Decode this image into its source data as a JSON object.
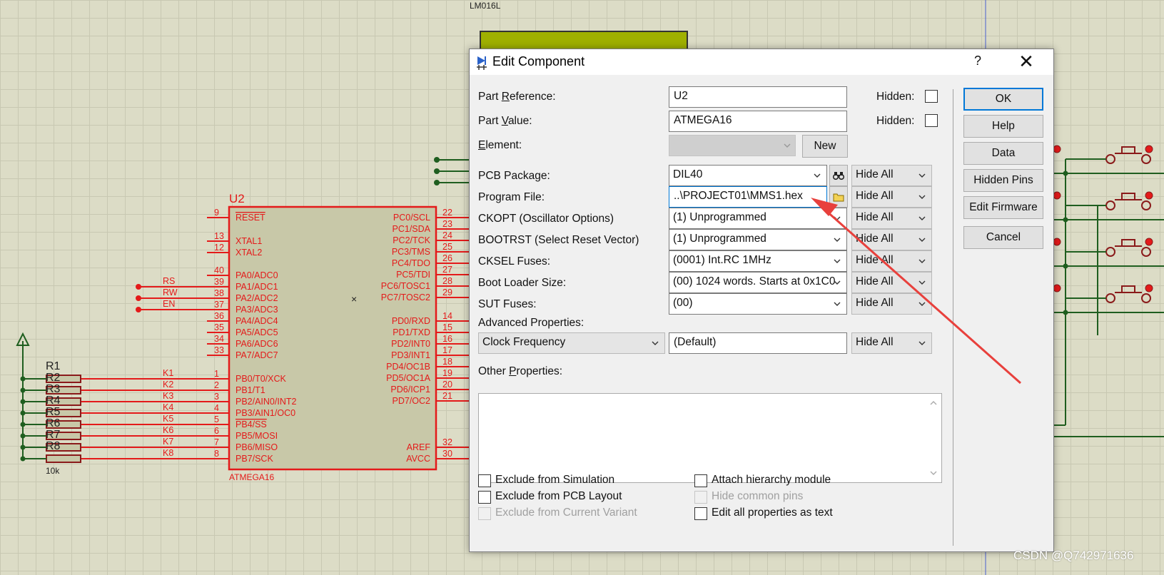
{
  "window": {
    "title": "Edit Component",
    "help_glyph": "?",
    "close_glyph": "✕"
  },
  "schematic": {
    "lcd_label": "LM016L",
    "chip": {
      "ref": "U2",
      "value": "ATMEGA16",
      "left_pins": [
        {
          "num": "9",
          "label": "RESET"
        },
        {
          "num": "13",
          "label": "XTAL1"
        },
        {
          "num": "12",
          "label": "XTAL2"
        },
        {
          "num": "40",
          "label": "PA0/ADC0"
        },
        {
          "num": "39",
          "label": "PA1/ADC1"
        },
        {
          "num": "38",
          "label": "PA2/ADC2"
        },
        {
          "num": "37",
          "label": "PA3/ADC3"
        },
        {
          "num": "36",
          "label": "PA4/ADC4"
        },
        {
          "num": "35",
          "label": "PA5/ADC5"
        },
        {
          "num": "34",
          "label": "PA6/ADC6"
        },
        {
          "num": "33",
          "label": "PA7/ADC7"
        },
        {
          "num": "1",
          "label": "PB0/T0/XCK"
        },
        {
          "num": "2",
          "label": "PB1/T1"
        },
        {
          "num": "3",
          "label": "PB2/AIN0/INT2"
        },
        {
          "num": "4",
          "label": "PB3/AIN1/OC0"
        },
        {
          "num": "5",
          "label": "PB4/SS"
        },
        {
          "num": "6",
          "label": "PB5/MOSI"
        },
        {
          "num": "7",
          "label": "PB6/MISO"
        },
        {
          "num": "8",
          "label": "PB7/SCK"
        }
      ],
      "right_pins": [
        {
          "num": "22",
          "label": "PC0/SCL"
        },
        {
          "num": "23",
          "label": "PC1/SDA"
        },
        {
          "num": "24",
          "label": "PC2/TCK"
        },
        {
          "num": "25",
          "label": "PC3/TMS"
        },
        {
          "num": "26",
          "label": "PC4/TDO"
        },
        {
          "num": "27",
          "label": "PC5/TDI"
        },
        {
          "num": "28",
          "label": "PC6/TOSC1"
        },
        {
          "num": "29",
          "label": "PC7/TOSC2"
        },
        {
          "num": "14",
          "label": "PD0/RXD"
        },
        {
          "num": "15",
          "label": "PD1/TXD"
        },
        {
          "num": "16",
          "label": "PD2/INT0"
        },
        {
          "num": "17",
          "label": "PD3/INT1"
        },
        {
          "num": "18",
          "label": "PD4/OC1B"
        },
        {
          "num": "19",
          "label": "PD5/OC1A"
        },
        {
          "num": "20",
          "label": "PD6/ICP1"
        },
        {
          "num": "21",
          "label": "PD7/OC2"
        },
        {
          "num": "32",
          "label": "AREF"
        },
        {
          "num": "30",
          "label": "AVCC"
        }
      ]
    },
    "net_labels": [
      "RS",
      "RW",
      "EN",
      "K1",
      "K2",
      "K3",
      "K4",
      "K5",
      "K6",
      "K7",
      "K8"
    ],
    "resistor_labels": [
      "R1",
      "R2",
      "R3",
      "R4",
      "R5",
      "R6",
      "R7",
      "R8"
    ],
    "resistor_value": "10k"
  },
  "form": {
    "part_reference": {
      "label_pre": "Part ",
      "label_u": "R",
      "label_post": "eference:",
      "value": "U2",
      "hidden_label": "Hidden:"
    },
    "part_value": {
      "label_pre": "Part ",
      "label_u": "V",
      "label_post": "alue:",
      "value": "ATMEGA16",
      "hidden_label": "Hidden:"
    },
    "element": {
      "label_u": "E",
      "label_post": "lement:",
      "value": "",
      "new_label": "New"
    },
    "rows": [
      {
        "label": "PCB Package:",
        "value": "DIL40",
        "vis": "Hide All"
      },
      {
        "label": "Program File:",
        "value": "..\\PROJECT01\\MMS1.hex",
        "vis": "Hide All"
      },
      {
        "label": "CKOPT (Oscillator Options)",
        "value": "(1) Unprogrammed",
        "vis": "Hide All"
      },
      {
        "label": "BOOTRST (Select Reset Vector)",
        "value": "(1) Unprogrammed",
        "vis": "Hide All"
      },
      {
        "label": "CKSEL Fuses:",
        "value": "(0001) Int.RC 1MHz",
        "vis": "Hide All"
      },
      {
        "label": "Boot Loader Size:",
        "value": "(00) 1024 words. Starts at 0x1C0",
        "vis": "Hide All"
      },
      {
        "label": "SUT Fuses:",
        "value": "(00)",
        "vis": "Hide All"
      }
    ],
    "advanced": {
      "label": "Advanced Properties:",
      "property": "Clock Frequency",
      "value": "(Default)",
      "vis": "Hide All"
    },
    "other": {
      "label_pre": "Other ",
      "label_u": "P",
      "label_post": "roperties:",
      "value": ""
    },
    "checkboxes_left": [
      {
        "label": "Exclude from Simulation",
        "enabled": true
      },
      {
        "label": "Exclude from PCB Layout",
        "enabled": true
      },
      {
        "label": "Exclude from Current Variant",
        "enabled": false
      }
    ],
    "checkboxes_right": [
      {
        "label": "Attach hierarchy module",
        "enabled": true
      },
      {
        "label": "Hide common pins",
        "enabled": false
      },
      {
        "label": "Edit all properties as text",
        "enabled": true
      }
    ]
  },
  "buttons": {
    "ok": "OK",
    "help": "Help",
    "data": "Data",
    "hidden_pins": "Hidden Pins",
    "edit_firmware": "Edit Firmware",
    "cancel": "Cancel"
  },
  "watermark": "CSDN @Q742971636",
  "colors": {
    "wire_red": "#e41a1a",
    "wire_green": "#1f5e1f",
    "chip_fill": "#c8c8a8",
    "arrow": "#e8403c"
  }
}
